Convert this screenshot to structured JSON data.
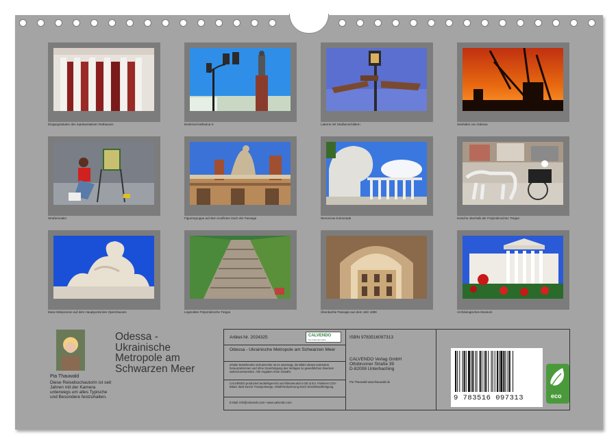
{
  "thumbnails": [
    {
      "caption": "Eingangssäulen des repräsentativen Rathauses"
    },
    {
      "caption": "Denkmal Katharina II."
    },
    {
      "caption": "Laterne mit Straßenschildern"
    },
    {
      "caption": "Seehafen von Odessa"
    },
    {
      "caption": "Straßenmaler"
    },
    {
      "caption": "Figurengruppe auf dem imoflicten Dach der Passage"
    },
    {
      "caption": "Woronzow-Kolonnade"
    },
    {
      "caption": "Kutsche oberhalb der Potjomkinschen Treppe"
    },
    {
      "caption": "Muse Melpomene auf dem Hauptportal des Opernhauses"
    },
    {
      "caption": "Legendäre Potjomkinsche Treppe"
    },
    {
      "caption": "Überdachte Passage aus dem Jahr 1899"
    },
    {
      "caption": "Archäologisches Museum"
    }
  ],
  "author": {
    "name": "Pia Thauwald",
    "bio": "Diese Reisebuchautorin ist seit Jahren mit der Kamera unterwegs um alles Typische und Besondere festzuhalten."
  },
  "title": "Odessa - Ukrainische Metropole am Schwarzen Meer",
  "info": {
    "article": "Artikel-Nr. 2024325",
    "logo": "CALVENDO",
    "logo_sub": "Die Kalendermarke",
    "subtitle": "Odessa - Ukrainische Metropole am Schwarzen Meer",
    "legal1": "Inhalte bestehender Schutzrechte ist es untersagt, die Bilder dieses Kalenders herauszutrennen und ohne Genehmigung des Verlages zu gewerblichen Zwecken weiterzuverwenden. Alle Angaben ohne Gewähr.",
    "legal2": "CALVENDO produziert bedarfsgerecht und klimaneutral in DE & EU. Positives CO2-Bilanz dank kurzer Transportwege, Abfall-Reduzierung durch Einzelstückfertigung.",
    "email": "E-Mail: info@calvendo.com • www.calvendo.com",
    "isbn": "ISBN 9783516097313",
    "publisher1": "CALVENDO Verlag GmbH",
    "publisher2": "Ottobrunner Straße 39",
    "publisher3": "D-82008 Unterhaching",
    "photographer": "Pia Thauwald www.thauwald.de",
    "barcode_digits": "9 783516 097313",
    "eco": "eco"
  }
}
